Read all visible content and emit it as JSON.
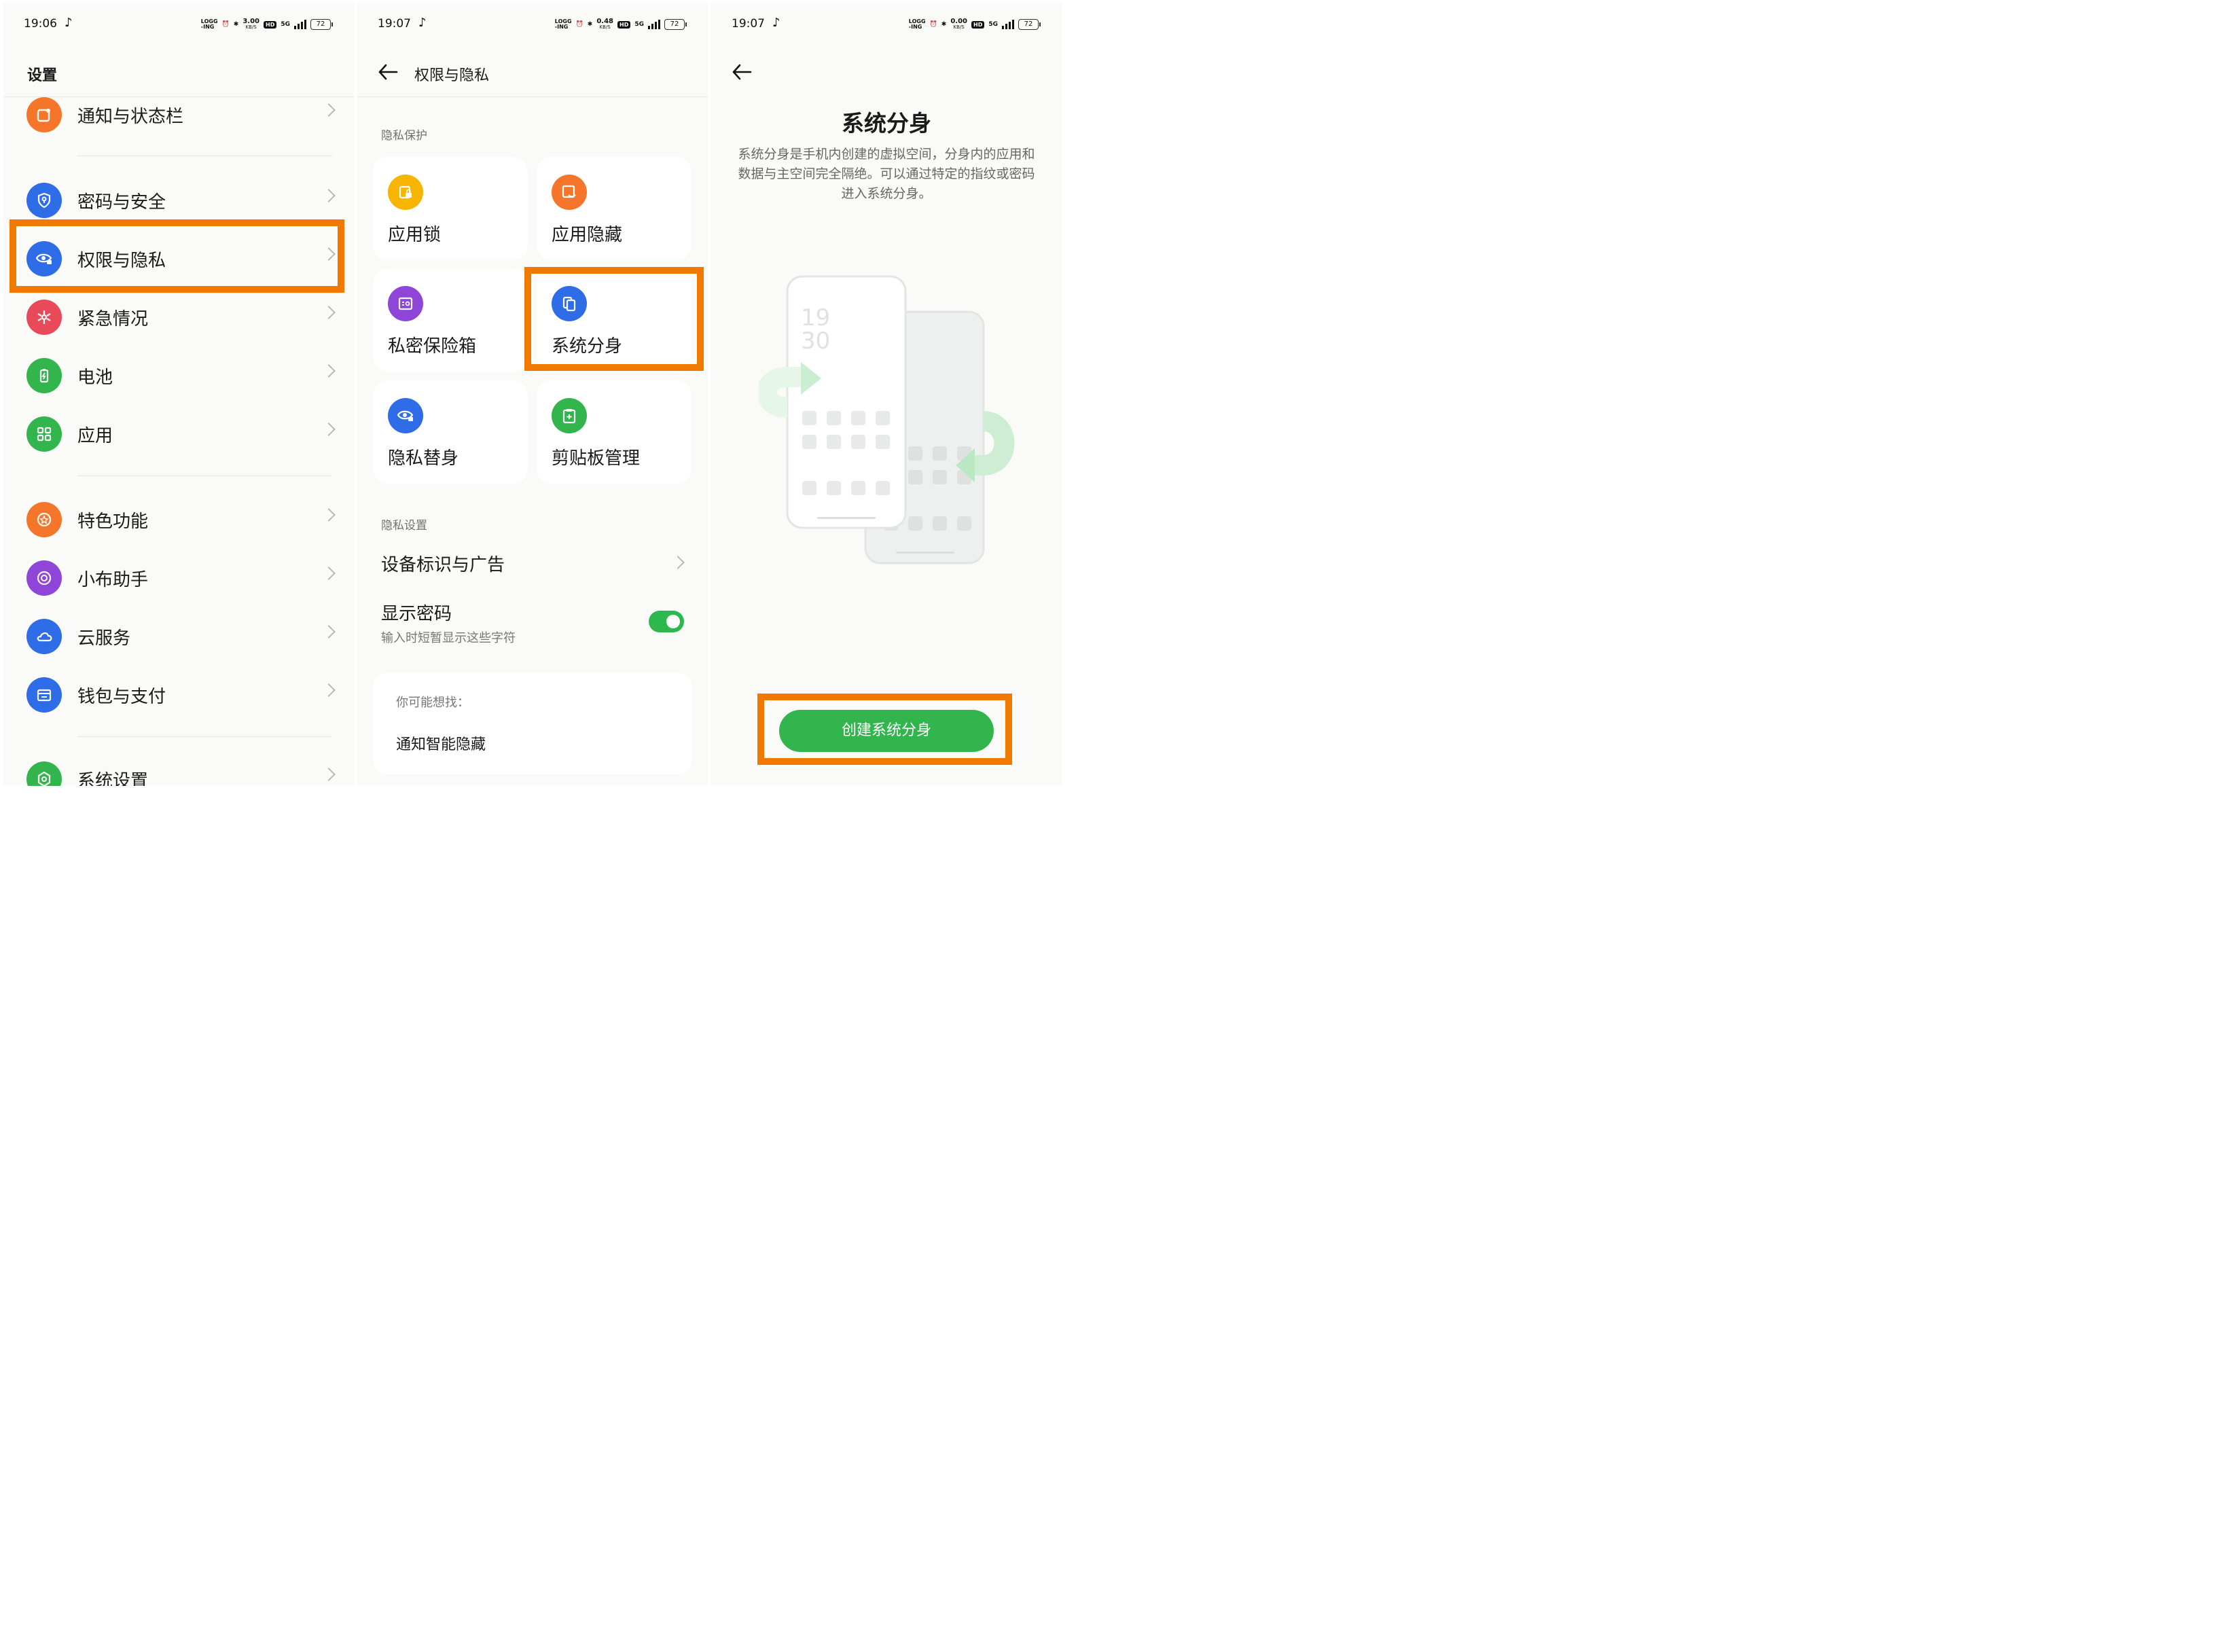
{
  "colors": {
    "highlight": "#f07a00",
    "toggle_on": "#2db84d",
    "primary_button": "#33b54e"
  },
  "panel1": {
    "status": {
      "time": "19:06",
      "speed": "3.00",
      "speed_unit": "KB/S",
      "hd": "HD",
      "net": "5G",
      "logging": "LOGG\n-ING",
      "battery": "72"
    },
    "title": "设置",
    "items": [
      {
        "label": "通知与状态栏",
        "icon": "notification-icon",
        "color": "#f5762a"
      },
      {
        "label": "密码与安全",
        "icon": "shield-key-icon",
        "color": "#2f6ce8"
      },
      {
        "label": "权限与隐私",
        "icon": "privacy-eye-icon",
        "color": "#2f6ce8"
      },
      {
        "label": "紧急情况",
        "icon": "emergency-icon",
        "color": "#e84a5a"
      },
      {
        "label": "电池",
        "icon": "battery-icon",
        "color": "#33b54e"
      },
      {
        "label": "应用",
        "icon": "apps-grid-icon",
        "color": "#33b54e"
      },
      {
        "label": "特色功能",
        "icon": "star-circle-icon",
        "color": "#f5762a"
      },
      {
        "label": "小布助手",
        "icon": "assistant-icon",
        "color": "#8f45d8"
      },
      {
        "label": "云服务",
        "icon": "cloud-icon",
        "color": "#2f6ce8"
      },
      {
        "label": "钱包与支付",
        "icon": "wallet-icon",
        "color": "#2f6ce8"
      },
      {
        "label": "系统设置",
        "icon": "system-settings-icon",
        "color": "#33b54e"
      }
    ]
  },
  "panel2": {
    "status": {
      "time": "19:07",
      "speed": "0.48",
      "speed_unit": "KB/S",
      "hd": "HD",
      "net": "5G",
      "logging": "LOGG\n-ING",
      "battery": "72"
    },
    "title": "权限与隐私",
    "section_protection": "隐私保护",
    "cards": [
      {
        "label": "应用锁",
        "icon": "app-lock-icon",
        "color": "#f7b500"
      },
      {
        "label": "应用隐藏",
        "icon": "app-hide-icon",
        "color": "#f5762a"
      },
      {
        "label": "私密保险箱",
        "icon": "private-safe-icon",
        "color": "#8f45d8"
      },
      {
        "label": "系统分身",
        "icon": "system-clone-icon",
        "color": "#2f6ce8"
      },
      {
        "label": "隐私替身",
        "icon": "privacy-substitute-icon",
        "color": "#2f6ce8"
      },
      {
        "label": "剪贴板管理",
        "icon": "clipboard-icon",
        "color": "#33b54e"
      }
    ],
    "section_settings": "隐私设置",
    "device_ads": "设备标识与广告",
    "show_password": "显示密码",
    "show_password_sub": "输入时短暂显示这些字符",
    "show_password_on": true,
    "suggest_title": "你可能想找：",
    "suggest_item": "通知智能隐藏"
  },
  "panel3": {
    "status": {
      "time": "19:07",
      "speed": "0.00",
      "speed_unit": "KB/S",
      "hd": "HD",
      "net": "5G",
      "logging": "LOGG\n-ING",
      "battery": "72"
    },
    "title": "系统分身",
    "description": "系统分身是手机内创建的虚拟空间，分身内的应用和数据与主空间完全隔绝。可以通过特定的指纹或密码进入系统分身。",
    "illustration_time_hour": "19",
    "illustration_time_min": "30",
    "create_button": "创建系统分身"
  }
}
